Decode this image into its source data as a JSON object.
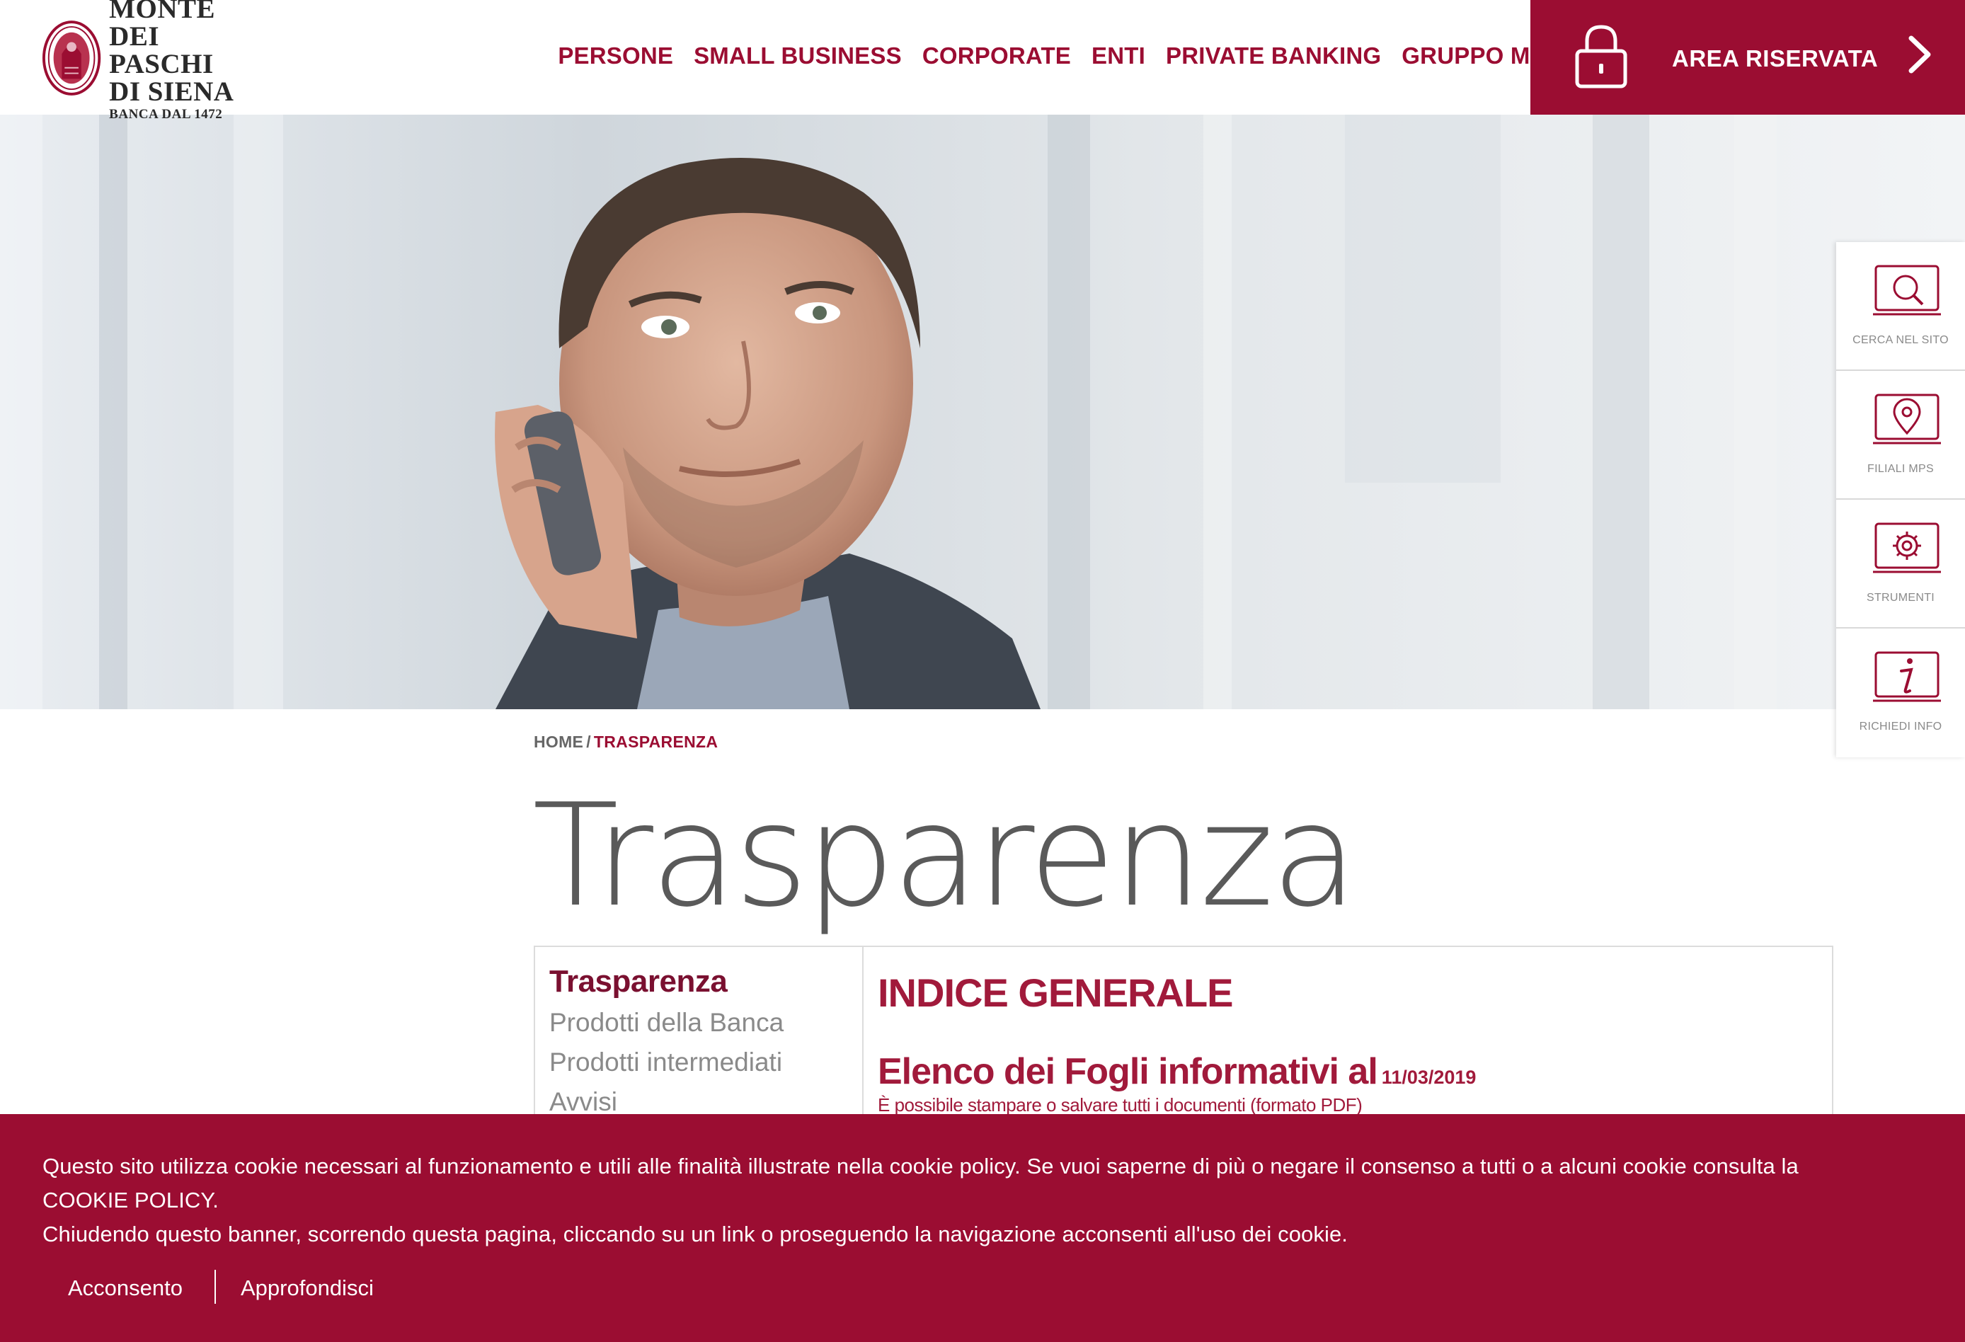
{
  "brand": {
    "name_line1": "MONTE",
    "name_line2": "DEI PASCHI",
    "name_line3": "DI SIENA",
    "tagline": "BANCA DAL 1472",
    "accent_color": "#9b0d32"
  },
  "nav": {
    "items": [
      "PERSONE",
      "SMALL BUSINESS",
      "CORPORATE",
      "ENTI",
      "PRIVATE BANKING",
      "GRUPPO MPS"
    ],
    "area_riservata": "AREA RISERVATA",
    "lock_icon": "lock-icon",
    "chevron_icon": "chevron-right-icon"
  },
  "tools": [
    {
      "label": "CERCA NEL SITO",
      "icon": "search-icon"
    },
    {
      "label": "FILIALI MPS",
      "icon": "map-pin-icon"
    },
    {
      "label": "STRUMENTI",
      "icon": "gear-icon"
    },
    {
      "label": "RICHIEDI INFO",
      "icon": "info-icon"
    }
  ],
  "breadcrumb": {
    "home": "HOME",
    "separator": "/",
    "current": "TRASPARENZA"
  },
  "page": {
    "title": "Trasparenza"
  },
  "sidebar": {
    "title": "Trasparenza",
    "links": [
      "Prodotti della Banca",
      "Prodotti intermediati",
      "Avvisi"
    ]
  },
  "main": {
    "index_title": "INDICE GENERALE",
    "fogli_title": "Elenco dei Fogli informativi al",
    "fogli_date": "11/03/2019",
    "fogli_subtitle": "È possibile stampare o salvare tutti i documenti (formato PDF)"
  },
  "cookie": {
    "line1": "Questo sito utilizza cookie necessari al funzionamento e utili alle finalità illustrate nella cookie policy. Se vuoi saperne di più o negare il consenso a tutti o a alcuni cookie consulta la",
    "line2": "COOKIE POLICY.",
    "line3": "Chiudendo questo banner, scorrendo questa pagina, cliccando su un link o proseguendo la navigazione acconsenti all'uso dei cookie.",
    "accept_label": "Acconsento",
    "more_label": "Approfondisci"
  }
}
